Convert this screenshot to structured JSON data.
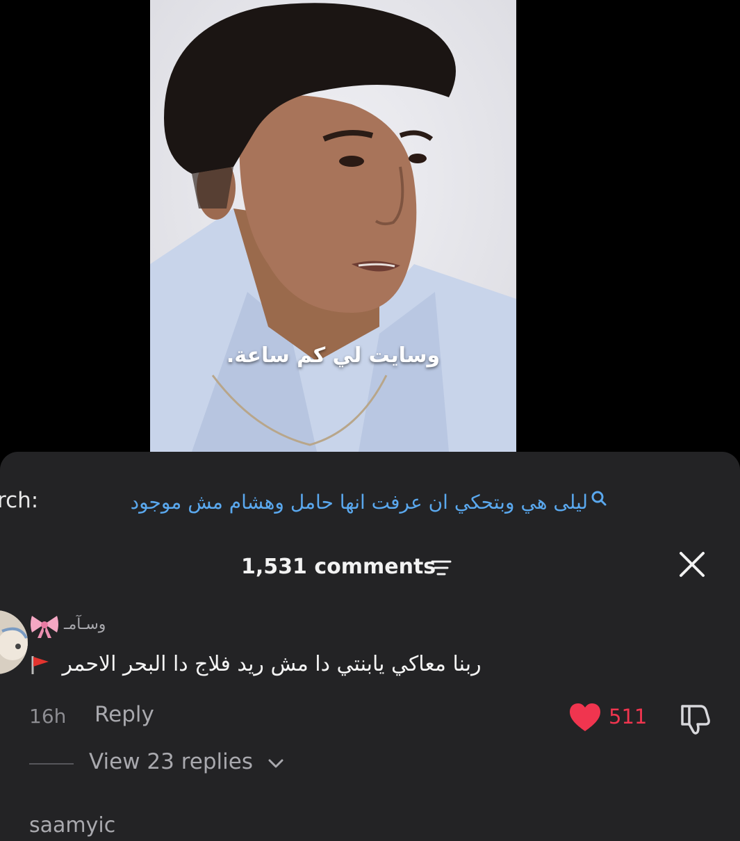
{
  "video": {
    "caption": "وسايت لي كم ساعة."
  },
  "search": {
    "prefix": "rch:",
    "query": "ليلى هي وبتحكي ان عرفت انها حامل وهشام مش موجود",
    "icon": "search-icon"
  },
  "comments_header": {
    "count_label": "1,531 comments",
    "sort_icon": "sort-lines-icon",
    "close_icon": "close-icon"
  },
  "comment": {
    "username": "وسـآمـ",
    "text": "ربنا معاكي يابنتي دا مش ريد فلاج دا البحر الاحمر",
    "time": "16h",
    "reply_label": "Reply",
    "likes": "511",
    "view_replies_label": "View 23 replies"
  },
  "next_comment": {
    "username": "saamyic"
  },
  "colors": {
    "sheet_bg": "#232325",
    "link_blue": "#5aa8ee",
    "like_red": "#f0354f",
    "muted": "#a9a9ae"
  }
}
